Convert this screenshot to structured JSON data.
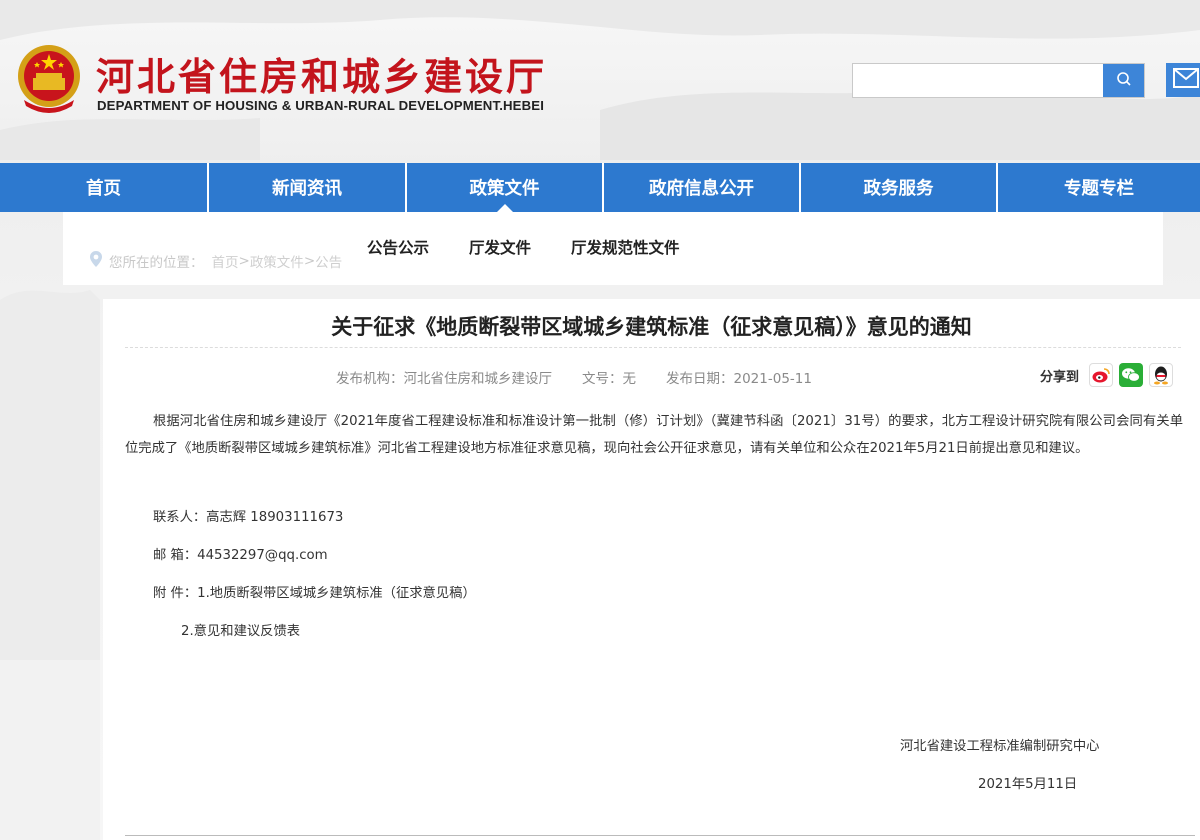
{
  "header": {
    "title": "河北省住房和城乡建设厅",
    "subtitle": "DEPARTMENT OF HOUSING & URBAN-RURAL DEVELOPMENT.HEBEI",
    "search_placeholder": "",
    "search_icon": "search-icon",
    "mail_icon": "mail-icon",
    "brand_color": "#c3141c",
    "accent_color": "#2d79cf"
  },
  "nav": {
    "items": [
      {
        "label": "首页"
      },
      {
        "label": "新闻资讯"
      },
      {
        "label": "政策文件"
      },
      {
        "label": "政府信息公开"
      },
      {
        "label": "政务服务"
      },
      {
        "label": "专题专栏"
      }
    ],
    "active_index": 2
  },
  "subnav": {
    "items": [
      {
        "label": "公告公示"
      },
      {
        "label": "厅发文件"
      },
      {
        "label": "厅发规范性文件"
      }
    ]
  },
  "breadcrumb": {
    "prefix": "您所在的位置：",
    "items": [
      "首页",
      "政策文件",
      "公告"
    ],
    "separator": ">"
  },
  "article": {
    "title": "关于征求《地质断裂带区域城乡建筑标准（征求意见稿）》意见的通知",
    "meta": {
      "publisher": "发布机构：河北省住房和城乡建设厅",
      "doc_no": "文号：无",
      "date": "发布日期：2021-05-11"
    },
    "share_label": "分享到",
    "share_icons": [
      "weibo-icon",
      "wechat-icon",
      "qq-icon"
    ],
    "paragraph": "根据河北省住房和城乡建设厅《2021年度省工程建设标准和标准设计第一批制（修）订计划》（冀建节科函〔2021〕31号）的要求，北方工程设计研究院有限公司会同有关单位完成了《地质断裂带区域城乡建筑标准》河北省工程建设地方标准征求意见稿，现向社会公开征求意见，请有关单位和公众在2021年5月21日前提出意见和建议。",
    "contact": "联系人：高志辉  18903111673",
    "email": "邮 箱：44532297@qq.com",
    "attachment_1": "附 件：1.地质断裂带区域城乡建筑标准（征求意见稿）",
    "attachment_2": "2.意见和建议反馈表",
    "signature_org": "河北省建设工程标准编制研究中心",
    "signature_date": "2021年5月11日"
  }
}
